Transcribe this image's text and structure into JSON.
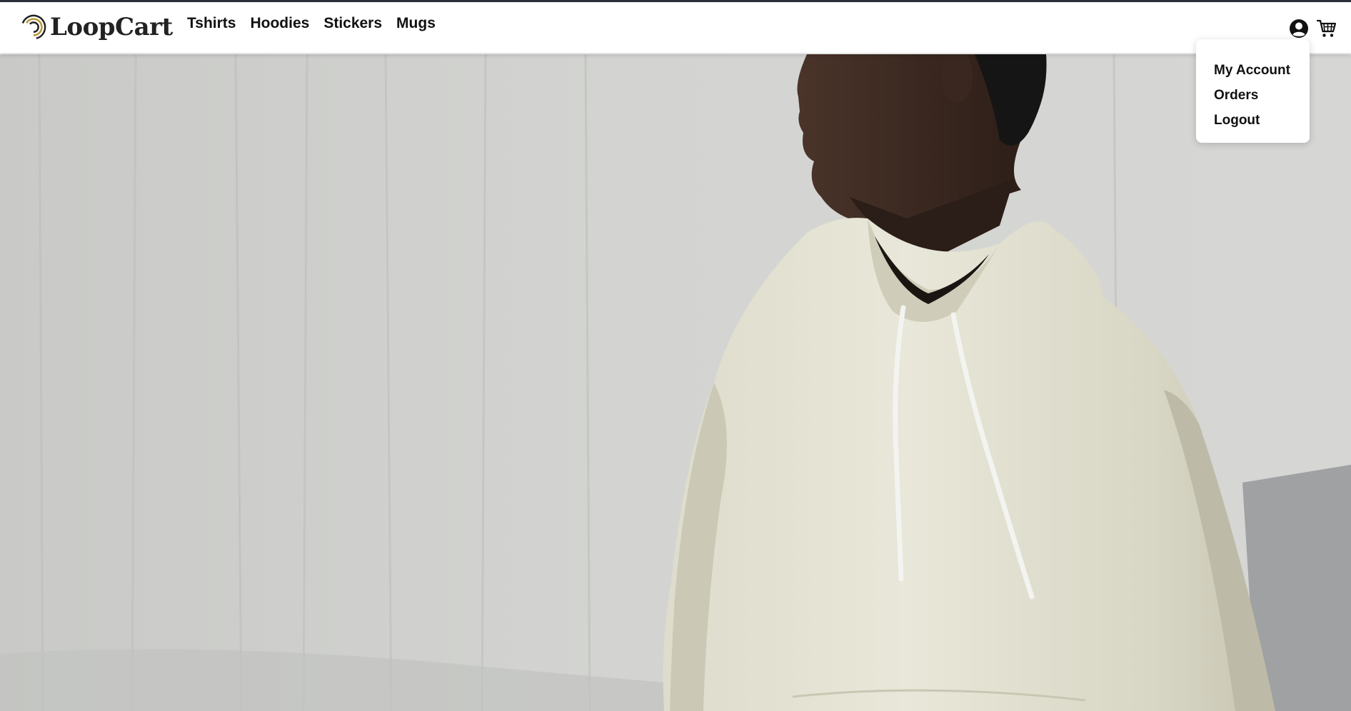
{
  "brand": {
    "name": "LoopCart",
    "logo_icon": "loop-logo-icon"
  },
  "nav": {
    "links": [
      {
        "label": "Tshirts"
      },
      {
        "label": "Hoodies"
      },
      {
        "label": "Stickers"
      },
      {
        "label": "Mugs"
      }
    ]
  },
  "header_icons": {
    "account": "account-circle-icon",
    "cart": "shopping-cart-icon"
  },
  "account_menu": {
    "open": true,
    "items": [
      {
        "label": "My Account"
      },
      {
        "label": "Orders"
      },
      {
        "label": "Logout"
      }
    ]
  },
  "hero": {
    "image": "man-in-cream-hoodie-photo"
  },
  "colors": {
    "topline": "#2b2f3a",
    "text": "#111111",
    "wall": "#cfd0cd",
    "hoodie": "#e3e2d3"
  }
}
